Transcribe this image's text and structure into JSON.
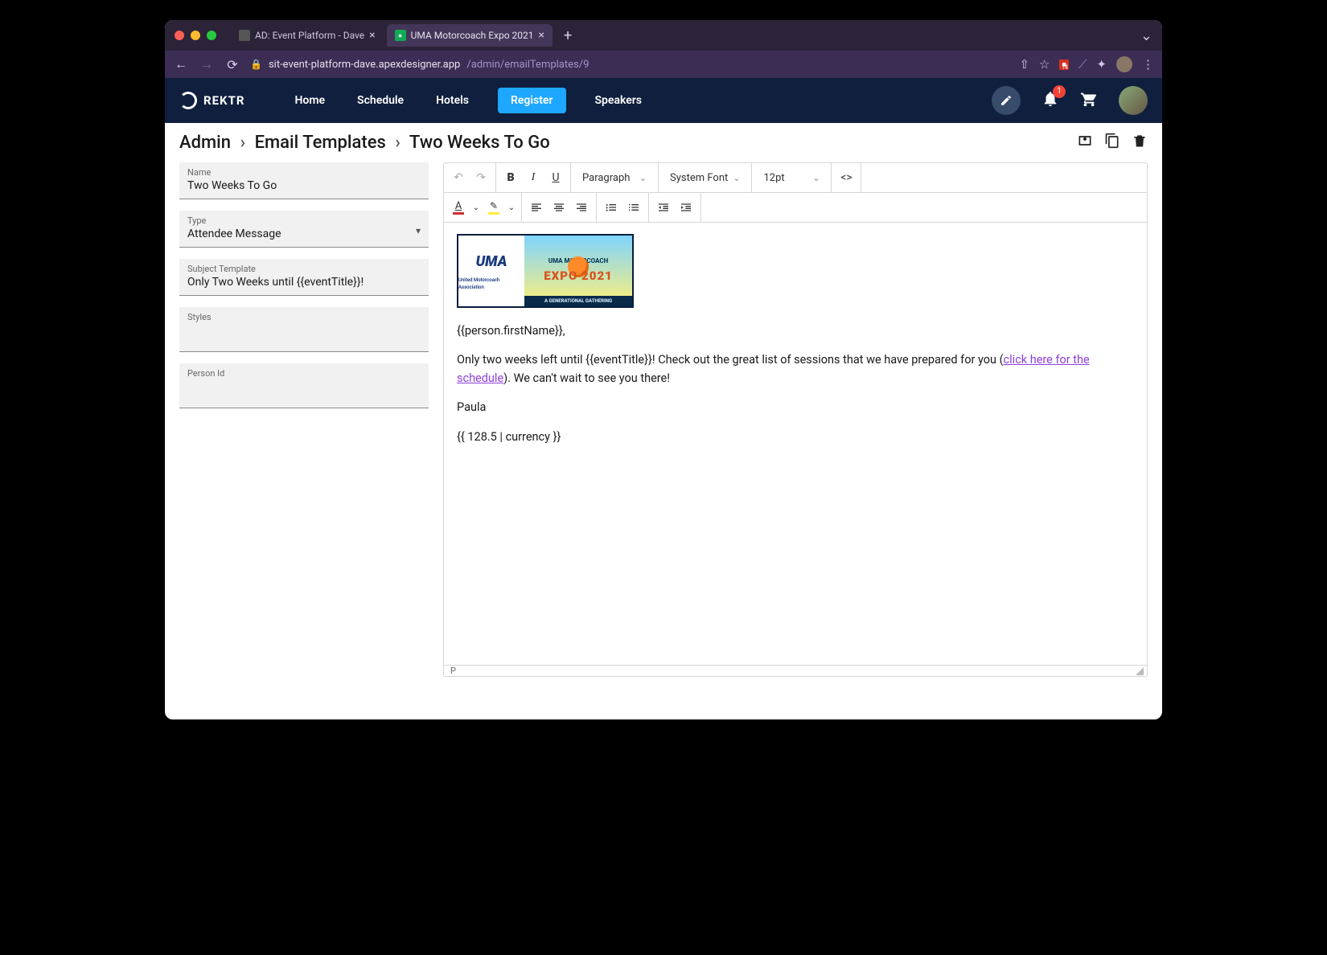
{
  "browser": {
    "tabs": [
      {
        "title": "AD: Event Platform - Dave",
        "active": false
      },
      {
        "title": "UMA Motorcoach Expo 2021",
        "active": true
      }
    ],
    "url_host": "sit-event-platform-dave.apexdesigner.app",
    "url_path": "/admin/emailTemplates/9",
    "ext_badge": "14"
  },
  "header": {
    "brand": "REKTR",
    "nav": [
      "Home",
      "Schedule",
      "Hotels",
      "Register",
      "Speakers"
    ],
    "register_label": "Register",
    "notif_count": "1"
  },
  "breadcrumb": {
    "a": "Admin",
    "b": "Email Templates",
    "c": "Two Weeks To Go"
  },
  "form": {
    "name_label": "Name",
    "name_value": "Two Weeks To Go",
    "type_label": "Type",
    "type_value": "Attendee Message",
    "subject_label": "Subject Template",
    "subject_value": "Only Two Weeks until {{eventTitle}}!",
    "styles_label": "Styles",
    "styles_value": "",
    "person_label": "Person Id",
    "person_value": ""
  },
  "editor_toolbar": {
    "block_format": "Paragraph",
    "font_family": "System Font",
    "font_size": "12pt"
  },
  "editor_body": {
    "banner_top": "UMA MOTORCOACH",
    "banner_expo": "EXPO 2021",
    "banner_sub": "A GENERATIONAL GATHERING",
    "banner_uma": "UMA",
    "banner_uma_small": "United Motorcoach Association",
    "p1": "{{person.firstName}},",
    "p2a": "Only two weeks left until {{eventTitle}}! Check out the great list of sessions that we have prepared for you (",
    "p2_link": "click here for the schedule",
    "p2b": "). We can't wait to see you there!",
    "p3": "Paula",
    "p4": "{{ 128.5 | currency }}"
  },
  "editor_status": "P"
}
